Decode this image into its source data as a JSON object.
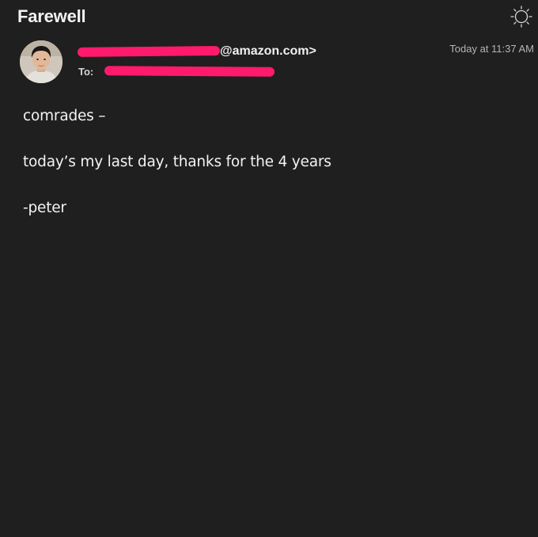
{
  "message": {
    "subject": "Farewell",
    "sender_domain": "@amazon.com>",
    "to_label": "To:",
    "timestamp": "Today at 11:37 AM",
    "body_lines": [
      "comrades –",
      "today’s my last day, thanks for the 4 years",
      "-peter"
    ]
  },
  "icons": {
    "theme_toggle": "sun-icon",
    "avatar": "avatar-photo"
  },
  "colors": {
    "background": "#1f1f1f",
    "redaction": "#ff1a6e",
    "text": "#f3f3f3",
    "muted_text": "#b4b4b4"
  }
}
